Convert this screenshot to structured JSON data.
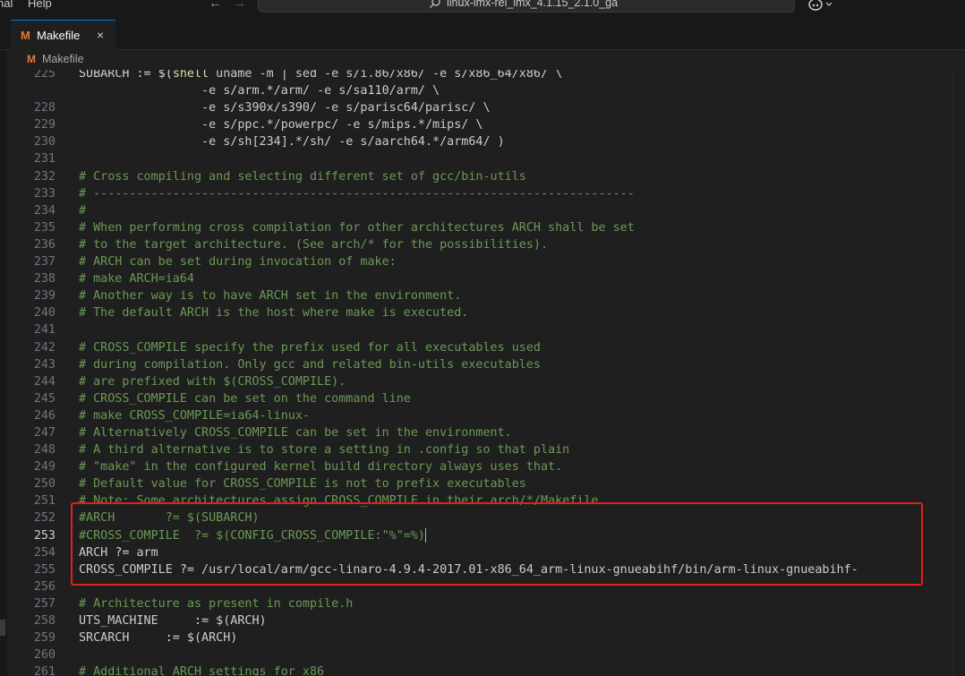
{
  "menu": {
    "item1": "nal",
    "item2": "Help"
  },
  "nav": {
    "back": "←",
    "forward": "→"
  },
  "command_center": {
    "text": "linux-imx-rel_imx_4.1.15_2.1.0_ga"
  },
  "tab": {
    "icon_letter": "M",
    "label": "Makefile",
    "close": "×"
  },
  "breadcrumb": {
    "icon_letter": "M",
    "label": "Makefile"
  },
  "editor": {
    "active_line": "253",
    "lines": [
      {
        "n": "225",
        "t": "SUBARCH := $(shell uname -m | sed -e s/i.86/x86/ -e s/x86_64/x86/ \\"
      },
      {
        "n": "",
        "t": "                 -e s/arm.*/arm/ -e s/sa110/arm/ \\"
      },
      {
        "n": "228",
        "t": "                 -e s/s390x/s390/ -e s/parisc64/parisc/ \\"
      },
      {
        "n": "229",
        "t": "                 -e s/ppc.*/powerpc/ -e s/mips.*/mips/ \\"
      },
      {
        "n": "230",
        "t": "                 -e s/sh[234].*/sh/ -e s/aarch64.*/arm64/ )"
      },
      {
        "n": "231",
        "t": ""
      },
      {
        "n": "232",
        "t": "# Cross compiling and selecting different set of gcc/bin-utils"
      },
      {
        "n": "233",
        "t": "# ---------------------------------------------------------------------------"
      },
      {
        "n": "234",
        "t": "#"
      },
      {
        "n": "235",
        "t": "# When performing cross compilation for other architectures ARCH shall be set"
      },
      {
        "n": "236",
        "t": "# to the target architecture. (See arch/* for the possibilities)."
      },
      {
        "n": "237",
        "t": "# ARCH can be set during invocation of make:"
      },
      {
        "n": "238",
        "t": "# make ARCH=ia64"
      },
      {
        "n": "239",
        "t": "# Another way is to have ARCH set in the environment."
      },
      {
        "n": "240",
        "t": "# The default ARCH is the host where make is executed."
      },
      {
        "n": "241",
        "t": ""
      },
      {
        "n": "242",
        "t": "# CROSS_COMPILE specify the prefix used for all executables used"
      },
      {
        "n": "243",
        "t": "# during compilation. Only gcc and related bin-utils executables"
      },
      {
        "n": "244",
        "t": "# are prefixed with $(CROSS_COMPILE)."
      },
      {
        "n": "245",
        "t": "# CROSS_COMPILE can be set on the command line"
      },
      {
        "n": "246",
        "t": "# make CROSS_COMPILE=ia64-linux-"
      },
      {
        "n": "247",
        "t": "# Alternatively CROSS_COMPILE can be set in the environment."
      },
      {
        "n": "248",
        "t": "# A third alternative is to store a setting in .config so that plain"
      },
      {
        "n": "249",
        "t": "# \"make\" in the configured kernel build directory always uses that."
      },
      {
        "n": "250",
        "t": "# Default value for CROSS_COMPILE is not to prefix executables"
      },
      {
        "n": "251",
        "t": "# Note: Some architectures assign CROSS_COMPILE in their arch/*/Makefile"
      },
      {
        "n": "252",
        "t": "#ARCH       ?= $(SUBARCH)"
      },
      {
        "n": "253",
        "t": "#CROSS_COMPILE  ?= $(CONFIG_CROSS_COMPILE:\"%\"=%)"
      },
      {
        "n": "254",
        "t": "ARCH ?= arm"
      },
      {
        "n": "255",
        "t": "CROSS_COMPILE ?= /usr/local/arm/gcc-linaro-4.9.4-2017.01-x86_64_arm-linux-gnueabihf/bin/arm-linux-gnueabihf-"
      },
      {
        "n": "256",
        "t": ""
      },
      {
        "n": "257",
        "t": "# Architecture as present in compile.h"
      },
      {
        "n": "258",
        "t": "UTS_MACHINE     := $(ARCH)"
      },
      {
        "n": "259",
        "t": "SRCARCH     := $(ARCH)"
      },
      {
        "n": "260",
        "t": ""
      },
      {
        "n": "261",
        "t": "# Additional ARCH settings for x86"
      }
    ]
  }
}
